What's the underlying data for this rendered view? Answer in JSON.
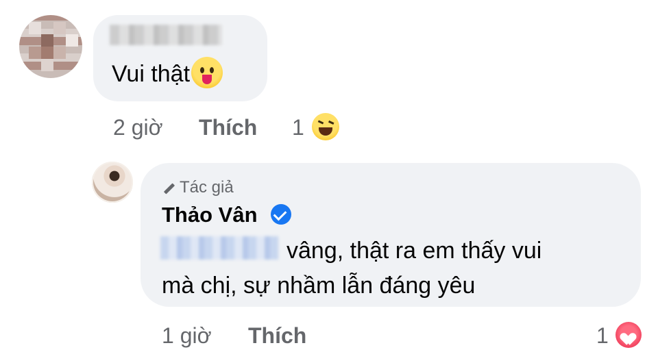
{
  "comment": {
    "text": "Vui thật",
    "emoji": "tongue-out-emoji",
    "time": "2 giờ",
    "like_label": "Thích",
    "reaction_count": "1",
    "reaction_emoji": "laughing-emoji"
  },
  "reply": {
    "badge": "Tác giả",
    "author": "Thảo Vân",
    "line1": "vâng, thật ra em thấy vui",
    "line2": "mà chị, sự nhầm lẫn đáng yêu",
    "time": "1 giờ",
    "like_label": "Thích",
    "reaction_count": "1",
    "reaction_emoji": "love-heart-icon"
  },
  "colors": {
    "bubble": "#f0f2f5",
    "meta_text": "#65676b",
    "verified": "#1877f2",
    "heart": "#e41e3f"
  }
}
